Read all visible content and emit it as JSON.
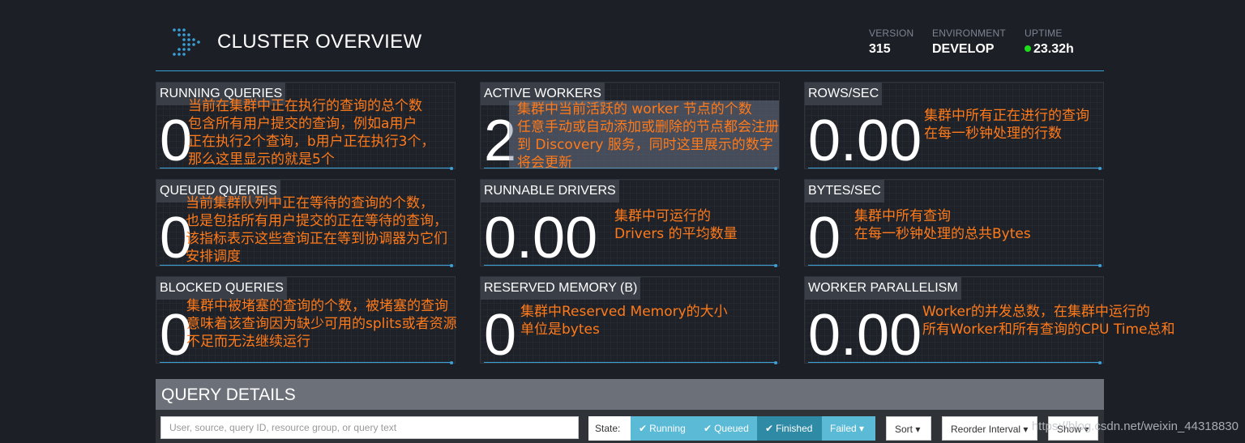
{
  "header": {
    "title": "CLUSTER OVERVIEW",
    "version_label": "VERSION",
    "version_value": "315",
    "environment_label": "ENVIRONMENT",
    "environment_value": "DEVELOP",
    "uptime_label": "UPTIME",
    "uptime_value": "23.32h",
    "uptime_status_color": "#1ddd1d"
  },
  "metrics": [
    {
      "title": "RUNNING QUERIES",
      "value": "0"
    },
    {
      "title": "ACTIVE WORKERS",
      "value": "2"
    },
    {
      "title": "ROWS/SEC",
      "value": "0.00"
    },
    {
      "title": "QUEUED QUERIES",
      "value": "0"
    },
    {
      "title": "RUNNABLE DRIVERS",
      "value": "0.00"
    },
    {
      "title": "BYTES/SEC",
      "value": "0"
    },
    {
      "title": "BLOCKED QUERIES",
      "value": "0"
    },
    {
      "title": "RESERVED MEMORY (B)",
      "value": "0"
    },
    {
      "title": "WORKER PARALLELISM",
      "value": "0.00"
    }
  ],
  "annotations": {
    "running": [
      "当前在集群中正在执行的查询的总个数",
      "包含所有用户提交的查询，例如a用户",
      "正在执行2个查询，b用户正在执行3个，",
      "那么这里显示的就是5个"
    ],
    "workers": [
      "集群中当前活跃的 worker 节点的个数",
      "任意手动或自动添加或删除的节点都会注册",
      "到 Discovery 服务，同时这里展示的数字",
      "将会更新"
    ],
    "rows": [
      "集群中所有正在进行的查询",
      "在每一秒钟处理的行数"
    ],
    "queued": [
      "当前集群队列中正在等待的查询的个数，",
      "也是包括所有用户提交的正在等待的查询，",
      "该指标表示这些查询正在等到协调器为它们",
      "安排调度"
    ],
    "drivers": [
      "集群中可运行的",
      "Drivers 的平均数量"
    ],
    "bytes": [
      "集群中所有查询",
      "在每一秒钟处理的总共Bytes"
    ],
    "blocked": [
      "集群中被堵塞的查询的个数，被堵塞的查询",
      "意味着该查询因为缺少可用的splits或者资源",
      "不足而无法继续运行"
    ],
    "memory": [
      "集群中Reserved Memory的大小",
      "单位是bytes"
    ],
    "parallelism": [
      "Worker的并发总数，在集群中运行的",
      "所有Worker和所有查询的CPU Time总和"
    ]
  },
  "query_details": {
    "title": "QUERY DETAILS",
    "search_placeholder": "User, source, query ID, resource group, or query text",
    "state_label": "State:",
    "running": "Running",
    "queued": "Queued",
    "finished": "Finished",
    "failed": "Failed",
    "sort": "Sort",
    "reorder": "Reorder Interval",
    "show": "Show"
  },
  "watermark": "https://blog.csdn.net/weixin_44318830",
  "colors": {
    "accent": "#3aa0d8",
    "annotation": "#ff7a1a"
  }
}
